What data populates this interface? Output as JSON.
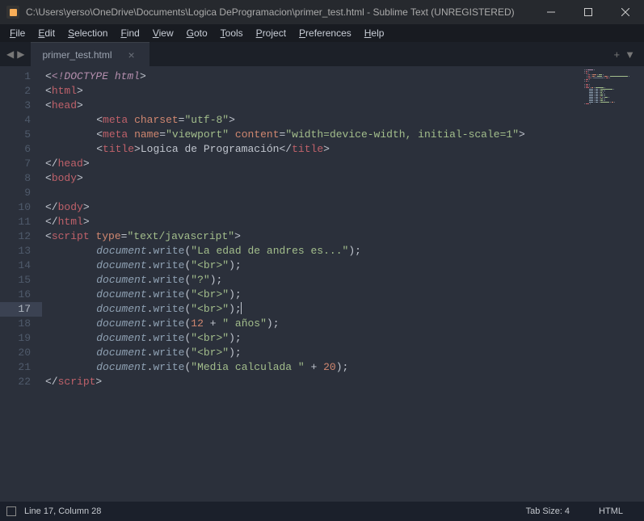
{
  "titlebar": {
    "path": "C:\\Users\\yerso\\OneDrive\\Documents\\Logica DeProgramacion\\primer_test.html - Sublime Text (UNREGISTERED)"
  },
  "menu": [
    "File",
    "Edit",
    "Selection",
    "Find",
    "View",
    "Goto",
    "Tools",
    "Project",
    "Preferences",
    "Help"
  ],
  "tab": {
    "name": "primer_test.html"
  },
  "status": {
    "cursor": "Line 17, Column 28",
    "tabsize": "Tab Size: 4",
    "syntax": "HTML"
  },
  "active_line": 17,
  "code": [
    {
      "n": 1,
      "ind": 0,
      "tokens": [
        [
          "p",
          "<"
        ],
        [
          "d",
          "<!"
        ],
        [
          "d",
          "DOCTYPE html"
        ],
        [
          "p",
          ">"
        ]
      ]
    },
    {
      "n": 2,
      "ind": 0,
      "tokens": [
        [
          "p",
          "<"
        ],
        [
          "t",
          "html"
        ],
        [
          "p",
          ">"
        ]
      ]
    },
    {
      "n": 3,
      "ind": 0,
      "tokens": [
        [
          "p",
          "<"
        ],
        [
          "t",
          "head"
        ],
        [
          "p",
          ">"
        ]
      ]
    },
    {
      "n": 4,
      "ind": 1,
      "tokens": [
        [
          "p",
          "<"
        ],
        [
          "t",
          "meta"
        ],
        [
          "p",
          " "
        ],
        [
          "a",
          "charset"
        ],
        [
          "p",
          "="
        ],
        [
          "s",
          "\"utf-8\""
        ],
        [
          "p",
          ">"
        ]
      ]
    },
    {
      "n": 5,
      "ind": 1,
      "tokens": [
        [
          "p",
          "<"
        ],
        [
          "t",
          "meta"
        ],
        [
          "p",
          " "
        ],
        [
          "a",
          "name"
        ],
        [
          "p",
          "="
        ],
        [
          "s",
          "\"viewport\""
        ],
        [
          "p",
          " "
        ],
        [
          "a",
          "content"
        ],
        [
          "p",
          "="
        ],
        [
          "s",
          "\"width=device-width, initial-scale=1\""
        ],
        [
          "p",
          ">"
        ]
      ]
    },
    {
      "n": 6,
      "ind": 1,
      "tokens": [
        [
          "p",
          "<"
        ],
        [
          "t",
          "title"
        ],
        [
          "p",
          ">"
        ],
        [
          "p",
          "Logica de Programación"
        ],
        [
          "p",
          "</"
        ],
        [
          "t",
          "title"
        ],
        [
          "p",
          ">"
        ]
      ]
    },
    {
      "n": 7,
      "ind": 0,
      "tokens": [
        [
          "p",
          "</"
        ],
        [
          "t",
          "head"
        ],
        [
          "p",
          ">"
        ]
      ]
    },
    {
      "n": 8,
      "ind": 0,
      "tokens": [
        [
          "p",
          "<"
        ],
        [
          "t",
          "body"
        ],
        [
          "p",
          ">"
        ]
      ]
    },
    {
      "n": 9,
      "ind": 0,
      "tokens": []
    },
    {
      "n": 10,
      "ind": 0,
      "tokens": [
        [
          "p",
          "</"
        ],
        [
          "t",
          "body"
        ],
        [
          "p",
          ">"
        ]
      ]
    },
    {
      "n": 11,
      "ind": 0,
      "tokens": [
        [
          "p",
          "</"
        ],
        [
          "t",
          "html"
        ],
        [
          "p",
          ">"
        ]
      ]
    },
    {
      "n": 12,
      "ind": 0,
      "tokens": [
        [
          "p",
          "<"
        ],
        [
          "t",
          "script"
        ],
        [
          "p",
          " "
        ],
        [
          "a",
          "type"
        ],
        [
          "p",
          "="
        ],
        [
          "s",
          "\"text/javascript\""
        ],
        [
          "p",
          ">"
        ]
      ]
    },
    {
      "n": 13,
      "ind": 2,
      "tokens": [
        [
          "v",
          "document"
        ],
        [
          "p",
          "."
        ],
        [
          "f",
          "write"
        ],
        [
          "p",
          "("
        ],
        [
          "s",
          "\"La edad de andres es...\""
        ],
        [
          "p",
          ");"
        ]
      ]
    },
    {
      "n": 14,
      "ind": 2,
      "tokens": [
        [
          "v",
          "document"
        ],
        [
          "p",
          "."
        ],
        [
          "f",
          "write"
        ],
        [
          "p",
          "("
        ],
        [
          "s",
          "\"<br>\""
        ],
        [
          "p",
          ");"
        ]
      ]
    },
    {
      "n": 15,
      "ind": 2,
      "tokens": [
        [
          "v",
          "document"
        ],
        [
          "p",
          "."
        ],
        [
          "f",
          "write"
        ],
        [
          "p",
          "("
        ],
        [
          "s",
          "\"?\""
        ],
        [
          "p",
          ");"
        ]
      ]
    },
    {
      "n": 16,
      "ind": 2,
      "tokens": [
        [
          "v",
          "document"
        ],
        [
          "p",
          "."
        ],
        [
          "f",
          "write"
        ],
        [
          "p",
          "("
        ],
        [
          "s",
          "\"<br>\""
        ],
        [
          "p",
          ");"
        ]
      ]
    },
    {
      "n": 17,
      "ind": 2,
      "tokens": [
        [
          "v",
          "document"
        ],
        [
          "p",
          "."
        ],
        [
          "f",
          "write"
        ],
        [
          "p",
          "("
        ],
        [
          "s",
          "\"<br>\""
        ],
        [
          "p",
          ");"
        ]
      ],
      "cursor": true
    },
    {
      "n": 18,
      "ind": 2,
      "tokens": [
        [
          "v",
          "document"
        ],
        [
          "p",
          "."
        ],
        [
          "f",
          "write"
        ],
        [
          "p",
          "("
        ],
        [
          "n",
          "12"
        ],
        [
          "p",
          " + "
        ],
        [
          "s",
          "\" años\""
        ],
        [
          "p",
          ");"
        ]
      ]
    },
    {
      "n": 19,
      "ind": 2,
      "tokens": [
        [
          "v",
          "document"
        ],
        [
          "p",
          "."
        ],
        [
          "f",
          "write"
        ],
        [
          "p",
          "("
        ],
        [
          "s",
          "\"<br>\""
        ],
        [
          "p",
          ");"
        ]
      ]
    },
    {
      "n": 20,
      "ind": 2,
      "tokens": [
        [
          "v",
          "document"
        ],
        [
          "p",
          "."
        ],
        [
          "f",
          "write"
        ],
        [
          "p",
          "("
        ],
        [
          "s",
          "\"<br>\""
        ],
        [
          "p",
          ");"
        ]
      ]
    },
    {
      "n": 21,
      "ind": 2,
      "tokens": [
        [
          "v",
          "document"
        ],
        [
          "p",
          "."
        ],
        [
          "f",
          "write"
        ],
        [
          "p",
          "("
        ],
        [
          "s",
          "\"Media calculada \""
        ],
        [
          "p",
          " + "
        ],
        [
          "n",
          "20"
        ],
        [
          "p",
          ");"
        ]
      ]
    },
    {
      "n": 22,
      "ind": 0,
      "tokens": [
        [
          "p",
          "</"
        ],
        [
          "t",
          "script"
        ],
        [
          "p",
          ">"
        ]
      ]
    }
  ]
}
